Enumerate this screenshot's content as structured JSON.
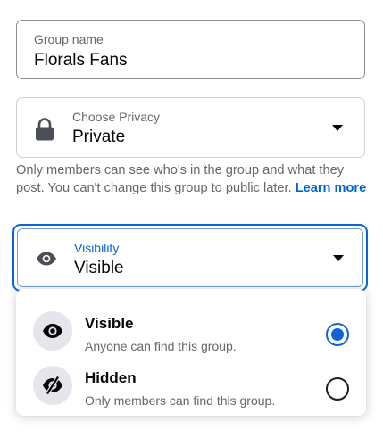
{
  "group_name": {
    "label": "Group name",
    "value": "Florals Fans"
  },
  "privacy": {
    "label": "Choose Privacy",
    "value": "Private",
    "icon": "lock-icon",
    "help_text": "Only members can see who's in the group and what they post. You can't change this group to public later.",
    "learn_more": "Learn more"
  },
  "visibility": {
    "label": "Visibility",
    "value": "Visible",
    "icon": "eye-icon",
    "options": [
      {
        "title": "Visible",
        "subtitle": "Anyone can find this group.",
        "icon": "eye-icon",
        "selected": true
      },
      {
        "title": "Hidden",
        "subtitle": "Only members can find this group.",
        "icon": "eye-slash-icon",
        "selected": false
      }
    ]
  },
  "colors": {
    "accent": "#0a66d8",
    "link": "#0064d1",
    "secondary_text": "#65676b",
    "icon_bg": "#e4e6eb"
  }
}
